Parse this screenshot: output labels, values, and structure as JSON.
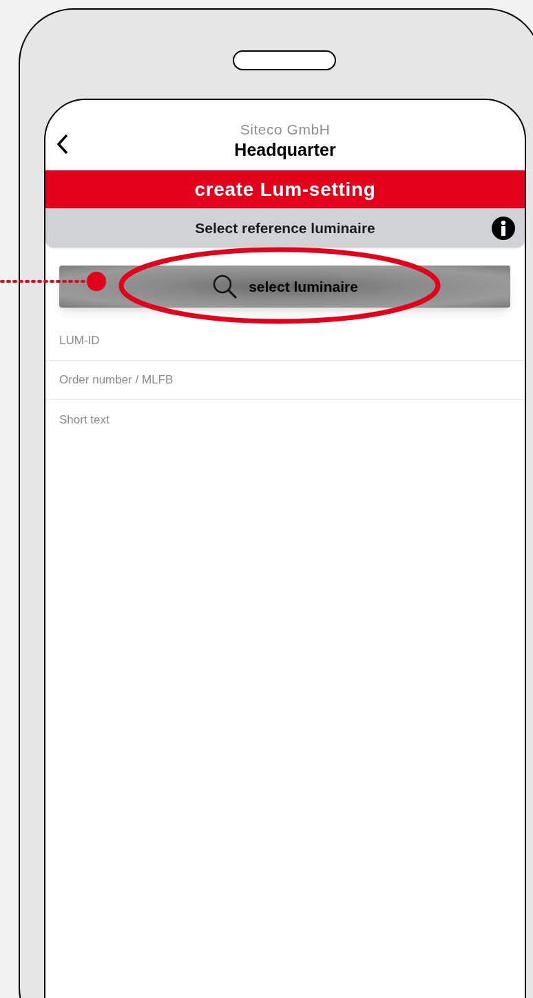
{
  "header": {
    "subtitle": "Siteco GmbH",
    "title": "Headquarter"
  },
  "banner": {
    "title": "create Lum-setting"
  },
  "section": {
    "title": "Select reference luminaire"
  },
  "select_button": {
    "label": "select luminaire"
  },
  "fields": [
    {
      "placeholder": "LUM-ID"
    },
    {
      "placeholder": "Order number / MLFB"
    },
    {
      "placeholder": "Short text"
    }
  ]
}
